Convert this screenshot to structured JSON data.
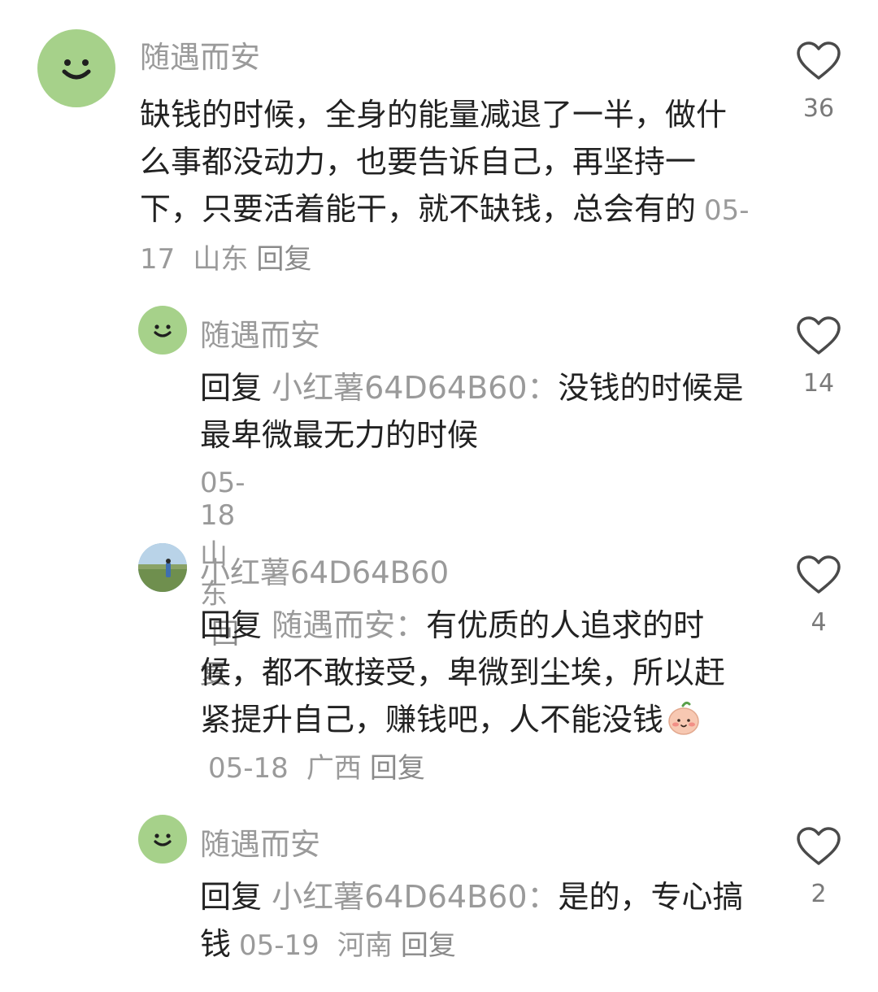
{
  "comments": [
    {
      "username": "随遇而安",
      "text": "缺钱的时候，全身的能量减退了一半，做什么事都没动力，也要告诉自己，再坚持一下，只要活着能干，就不缺钱，总会有的",
      "date": "05-17",
      "location": "山东",
      "reply_label": "回复",
      "likes": "36",
      "avatar_icon": "smiley-face-icon"
    },
    {
      "username": "随遇而安",
      "reply_prefix": "回复",
      "mention": "小红薯64D64B60：",
      "text": "没钱的时候是最卑微最无力的时候",
      "date": "05-18",
      "location": "山东",
      "reply_label": "回复",
      "likes": "14",
      "avatar_icon": "smiley-face-icon"
    },
    {
      "username": "小红薯64D64B60",
      "reply_prefix": "回复",
      "mention": "随遇而安：",
      "text": "有优质的人追求的时候，都不敢接受，卑微到尘埃，所以赶紧提升自己，赚钱吧，人不能没钱",
      "emoji": "blushing-face-emoji",
      "date": "05-18",
      "location": "广西",
      "reply_label": "回复",
      "likes": "4",
      "avatar_icon": "photo-avatar"
    },
    {
      "username": "随遇而安",
      "reply_prefix": "回复",
      "mention": "小红薯64D64B60：",
      "text": "是的，专心搞钱",
      "date": "05-19",
      "location": "河南",
      "reply_label": "回复",
      "likes": "2",
      "avatar_icon": "smiley-face-icon"
    }
  ],
  "colors": {
    "avatar_green": "#a6d18a",
    "secondary_text": "#9a9a9a",
    "primary_text": "#222222"
  }
}
